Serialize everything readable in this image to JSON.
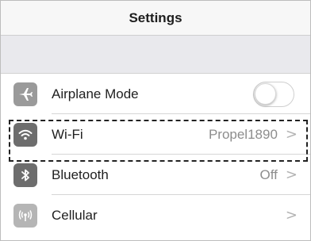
{
  "navbar": {
    "title": "Settings"
  },
  "rows": [
    {
      "label": "Airplane Mode",
      "icon": "airplane-icon",
      "icon_color": "#9a9a9a",
      "control": "toggle",
      "toggle_on": false
    },
    {
      "label": "Wi-Fi",
      "icon": "wifi-icon",
      "icon_color": "#6d6d6d",
      "value": "Propel1890",
      "chevron": ">"
    },
    {
      "label": "Bluetooth",
      "icon": "bluetooth-icon",
      "icon_color": "#6d6d6d",
      "value": "Off",
      "chevron": ">"
    },
    {
      "label": "Cellular",
      "icon": "cellular-icon",
      "icon_color": "#b5b5b5",
      "chevron": ">"
    }
  ]
}
